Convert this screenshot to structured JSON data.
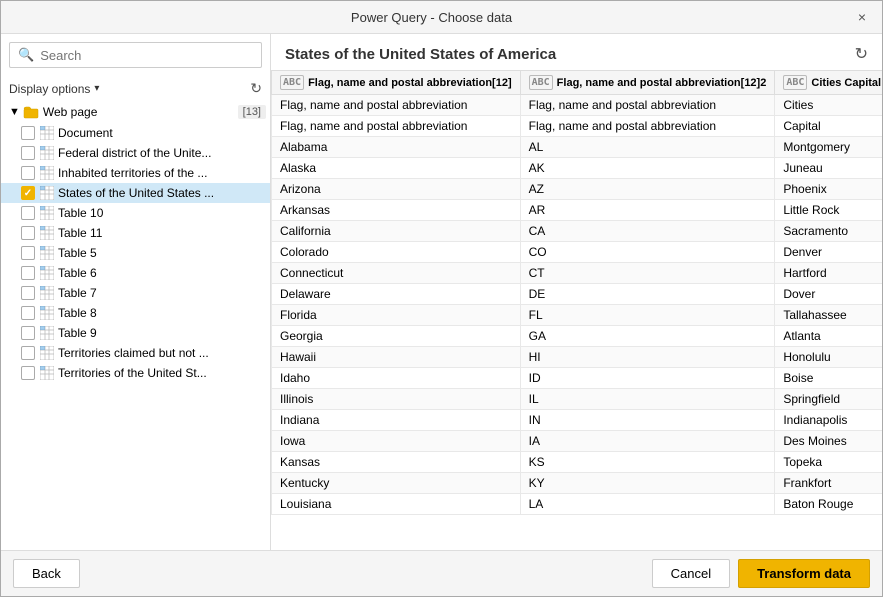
{
  "dialog": {
    "title": "Power Query - Choose data",
    "close_label": "×"
  },
  "left_panel": {
    "search": {
      "placeholder": "Search",
      "value": ""
    },
    "display_options_label": "Display options",
    "tree": {
      "root_label": "Web page",
      "root_badge": "[13]",
      "items": [
        {
          "label": "Document",
          "selected": false,
          "checked": false,
          "indent": 2
        },
        {
          "label": "Federal district of the Unite...",
          "selected": false,
          "checked": false,
          "indent": 2
        },
        {
          "label": "Inhabited territories of the ...",
          "selected": false,
          "checked": false,
          "indent": 2
        },
        {
          "label": "States of the United States ...",
          "selected": true,
          "checked": true,
          "indent": 2
        },
        {
          "label": "Table 10",
          "selected": false,
          "checked": false,
          "indent": 2
        },
        {
          "label": "Table 11",
          "selected": false,
          "checked": false,
          "indent": 2
        },
        {
          "label": "Table 5",
          "selected": false,
          "checked": false,
          "indent": 2
        },
        {
          "label": "Table 6",
          "selected": false,
          "checked": false,
          "indent": 2
        },
        {
          "label": "Table 7",
          "selected": false,
          "checked": false,
          "indent": 2
        },
        {
          "label": "Table 8",
          "selected": false,
          "checked": false,
          "indent": 2
        },
        {
          "label": "Table 9",
          "selected": false,
          "checked": false,
          "indent": 2
        },
        {
          "label": "Territories claimed but not ...",
          "selected": false,
          "checked": false,
          "indent": 2
        },
        {
          "label": "Territories of the United St...",
          "selected": false,
          "checked": false,
          "indent": 2
        }
      ]
    }
  },
  "right_panel": {
    "title": "States of the United States of America",
    "columns": [
      {
        "icon": "ABC",
        "label": "Flag, name and postal abbreviation[12]"
      },
      {
        "icon": "ABC",
        "label": "Flag, name and postal abbreviation[12]2"
      },
      {
        "icon": "ABC",
        "label": "Cities Capital"
      }
    ],
    "rows": [
      [
        "Flag, name and postal abbreviation",
        "Flag, name and postal abbreviation",
        "Cities"
      ],
      [
        "Flag, name and postal abbreviation",
        "Flag, name and postal abbreviation",
        "Capital"
      ],
      [
        "Alabama",
        "AL",
        "Montgomery"
      ],
      [
        "Alaska",
        "AK",
        "Juneau"
      ],
      [
        "Arizona",
        "AZ",
        "Phoenix"
      ],
      [
        "Arkansas",
        "AR",
        "Little Rock"
      ],
      [
        "California",
        "CA",
        "Sacramento"
      ],
      [
        "Colorado",
        "CO",
        "Denver"
      ],
      [
        "Connecticut",
        "CT",
        "Hartford"
      ],
      [
        "Delaware",
        "DE",
        "Dover"
      ],
      [
        "Florida",
        "FL",
        "Tallahassee"
      ],
      [
        "Georgia",
        "GA",
        "Atlanta"
      ],
      [
        "Hawaii",
        "HI",
        "Honolulu"
      ],
      [
        "Idaho",
        "ID",
        "Boise"
      ],
      [
        "Illinois",
        "IL",
        "Springfield"
      ],
      [
        "Indiana",
        "IN",
        "Indianapolis"
      ],
      [
        "Iowa",
        "IA",
        "Des Moines"
      ],
      [
        "Kansas",
        "KS",
        "Topeka"
      ],
      [
        "Kentucky",
        "KY",
        "Frankfort"
      ],
      [
        "Louisiana",
        "LA",
        "Baton Rouge"
      ]
    ]
  },
  "footer": {
    "back_label": "Back",
    "cancel_label": "Cancel",
    "transform_label": "Transform data"
  }
}
